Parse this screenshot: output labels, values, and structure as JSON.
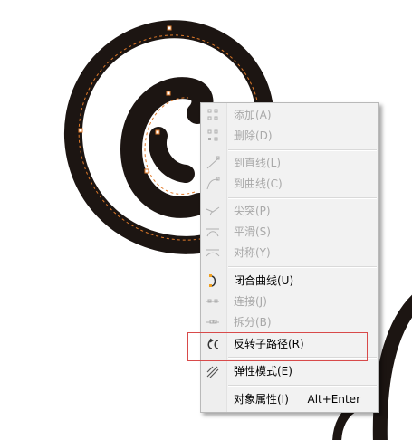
{
  "menu": {
    "items": [
      {
        "label": "添加(A)",
        "icon": "add-node-icon",
        "enabled": false
      },
      {
        "label": "删除(D)",
        "icon": "delete-node-icon",
        "enabled": false
      },
      {
        "label": "到直线(L)",
        "icon": "to-line-icon",
        "enabled": false
      },
      {
        "label": "到曲线(C)",
        "icon": "to-curve-icon",
        "enabled": false
      },
      {
        "label": "尖突(P)",
        "icon": "cusp-node-icon",
        "enabled": false
      },
      {
        "label": "平滑(S)",
        "icon": "smooth-node-icon",
        "enabled": false
      },
      {
        "label": "对称(Y)",
        "icon": "symmetrical-node-icon",
        "enabled": false
      },
      {
        "label": "闭合曲线(U)",
        "icon": "close-curve-icon",
        "enabled": true
      },
      {
        "label": "连接(J)",
        "icon": "join-nodes-icon",
        "enabled": false
      },
      {
        "label": "拆分(B)",
        "icon": "break-node-icon",
        "enabled": false
      },
      {
        "label": "反转子路径(R)",
        "icon": "reverse-subpath-icon",
        "enabled": true
      },
      {
        "label": "弹性模式(E)",
        "icon": "elastic-mode-icon",
        "enabled": true
      },
      {
        "label": "对象属性(I)",
        "shortcut": "Alt+Enter",
        "enabled": true
      }
    ]
  },
  "colors": {
    "spiral": "#1c1512",
    "selection_dash": "#e07a2a",
    "highlight_box": "#d84a4a"
  }
}
